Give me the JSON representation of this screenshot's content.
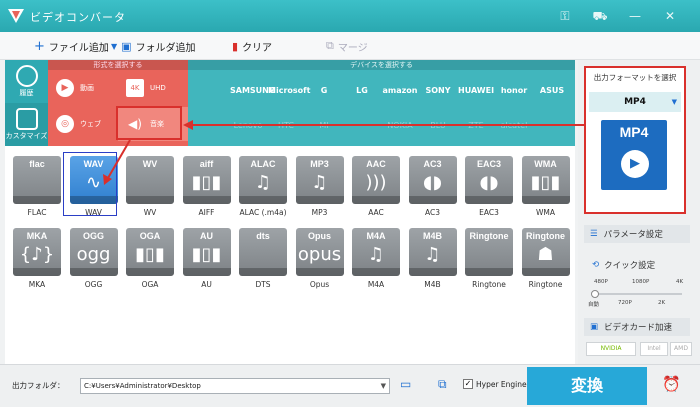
{
  "window": {
    "title": "ビデオコンバータ"
  },
  "toolbar": {
    "add_file": "ファイル追加",
    "add_folder": "フォルダ追加",
    "clear": "クリア",
    "merge": "マージ"
  },
  "side": {
    "history": "履歴",
    "customize": "カスタマイズ"
  },
  "format_panel": {
    "header": "形式を選択する",
    "video": "動画",
    "uhd": "UHD",
    "web": "ウェブ",
    "music": "音楽"
  },
  "device_panel": {
    "header": "デバイスを選択する",
    "row1": [
      "",
      "SAMSUNG",
      "Microsoft",
      "G",
      "LG",
      "amazon",
      "SONY",
      "HUAWEI",
      "honor",
      "ASUS"
    ],
    "row2": [
      "",
      "Lenovo",
      "HTC",
      "MI",
      "",
      "NOKIA",
      "BLU",
      "ZTE",
      "alcatel",
      ""
    ]
  },
  "formats": [
    {
      "name": "FLAC",
      "badge": "flac",
      "symbol": ""
    },
    {
      "name": "WAV",
      "badge": "WAV",
      "symbol": "∿"
    },
    {
      "name": "WV",
      "badge": "WV",
      "symbol": ""
    },
    {
      "name": "AIFF",
      "badge": "aiff",
      "symbol": "▮▯▮"
    },
    {
      "name": "ALAC (.m4a)",
      "badge": "ALAC",
      "symbol": "♫"
    },
    {
      "name": "MP3",
      "badge": "MP3",
      "symbol": "♫"
    },
    {
      "name": "AAC",
      "badge": "AAC",
      "symbol": ")))"
    },
    {
      "name": "AC3",
      "badge": "AC3",
      "symbol": "◖◗"
    },
    {
      "name": "EAC3",
      "badge": "EAC3",
      "symbol": "◖◗"
    },
    {
      "name": "WMA",
      "badge": "WMA",
      "symbol": "▮▯▮"
    },
    {
      "name": "MKA",
      "badge": "MKA",
      "symbol": "{♪}"
    },
    {
      "name": "OGG",
      "badge": "OGG",
      "symbol": "ogg"
    },
    {
      "name": "OGA",
      "badge": "OGA",
      "symbol": "▮▯▮"
    },
    {
      "name": "AU",
      "badge": "AU",
      "symbol": "▮▯▮"
    },
    {
      "name": "DTS",
      "badge": "dts",
      "symbol": ""
    },
    {
      "name": "Opus",
      "badge": "Opus",
      "symbol": "opus"
    },
    {
      "name": "M4A",
      "badge": "M4A",
      "symbol": "♫"
    },
    {
      "name": "M4B",
      "badge": "M4B",
      "symbol": "♫"
    },
    {
      "name": "Ringtone",
      "badge": "Ringtone",
      "symbol": ""
    },
    {
      "name": "Ringtone",
      "badge": "Ringtone",
      "symbol": "☗"
    }
  ],
  "output_format": {
    "title": "出力フォーマットを選択",
    "value": "MP4"
  },
  "params": "パラメータ設定",
  "quick": {
    "label": "クイック設定",
    "top_ticks": [
      "480P",
      "1080P",
      "4K"
    ],
    "bottom_ticks": [
      "自動",
      "720P",
      "2K"
    ]
  },
  "gpu": {
    "label": "ビデオカード加速",
    "nvidia": "NVIDIA",
    "intel": "Intel",
    "amd": "AMD"
  },
  "bottom": {
    "folder_label": "出力フォルダ：",
    "path": "C:¥Users¥Administrator¥Desktop",
    "hyper": "Hyper Engine",
    "convert": "変換"
  },
  "colors": {
    "teal": "#2fa9b2",
    "coral": "#e9645b",
    "convert": "#27a8d8",
    "highlight_red": "#d9302c",
    "selection_blue": "#2b3fc6"
  }
}
